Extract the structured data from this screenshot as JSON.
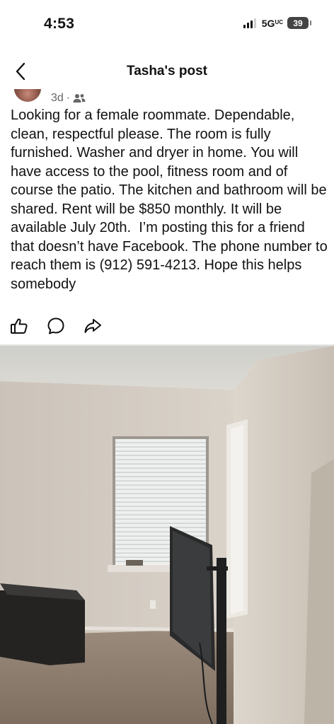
{
  "status": {
    "time": "4:53",
    "network": "5G",
    "network_sub": "UC",
    "battery": "39"
  },
  "header": {
    "title": "Tasha's post"
  },
  "post": {
    "time": "3d",
    "separator": "·",
    "body": "Looking for a female roommate. Dependable, clean, respectful please. The room is fully furnished. Washer and dryer in home. You will have access to the pool, fitness room and of course the patio. The kitchen and bathroom will be shared. Rent will be $850 monthly. It will be available July 20th.  I’m posting this for a friend that doesn’t have Facebook. The phone number to reach them is (912) 591-4213. Hope this helps somebody"
  },
  "icons": {
    "back": "chevron-left-icon",
    "audience": "friends-icon",
    "like": "thumbs-up-icon",
    "comment": "comment-bubble-icon",
    "share": "share-arrow-icon"
  },
  "colors": {
    "text": "#111111",
    "meta": "#666666",
    "wall": "#d9d2c8",
    "carpet": "#8f7f6f"
  }
}
